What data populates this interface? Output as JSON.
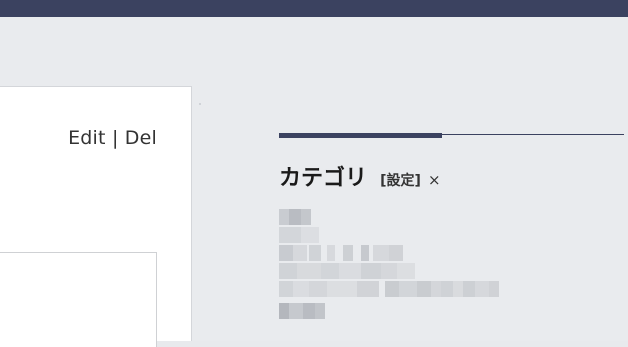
{
  "post_actions": {
    "edit_label": "Edit",
    "separator": "|",
    "delete_label": "Del"
  },
  "sidebar": {
    "category_widget": {
      "title": "カテゴリ",
      "settings_label": "[設定]",
      "close_label": "×",
      "items_state": "pixelated / obscured"
    }
  },
  "colors": {
    "topbar": "#3b4260",
    "accent_rule": "#3b4260",
    "page_background": "#e9ebee",
    "panel_background": "#ffffff"
  }
}
